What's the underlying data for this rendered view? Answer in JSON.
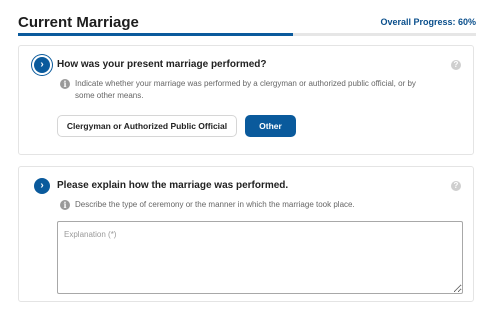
{
  "header": {
    "title": "Current Marriage",
    "progress_label": "Overall Progress: 60%",
    "progress_fraction": 0.6
  },
  "questions": [
    {
      "question": "How was your present marriage performed?",
      "hint_line1": "Indicate whether your marriage was performed by a clergyman or authorized public official, or by",
      "hint_line2": "some other means.",
      "options": [
        {
          "label": "Clergyman or Authorized Public Official",
          "selected": false
        },
        {
          "label": "Other",
          "selected": true
        }
      ]
    },
    {
      "question": "Please explain how the marriage was performed.",
      "hint": "Describe the type of ceremony or the manner in which the marriage took place.",
      "input_placeholder": "Explanation (*)",
      "input_value": ""
    }
  ],
  "icons": {
    "chevron": "chevron-right-icon",
    "help": "question-mark-icon",
    "info": "info-icon"
  },
  "colors": {
    "accent": "#0a5a9c",
    "progress_text": "#0a4f8c"
  }
}
